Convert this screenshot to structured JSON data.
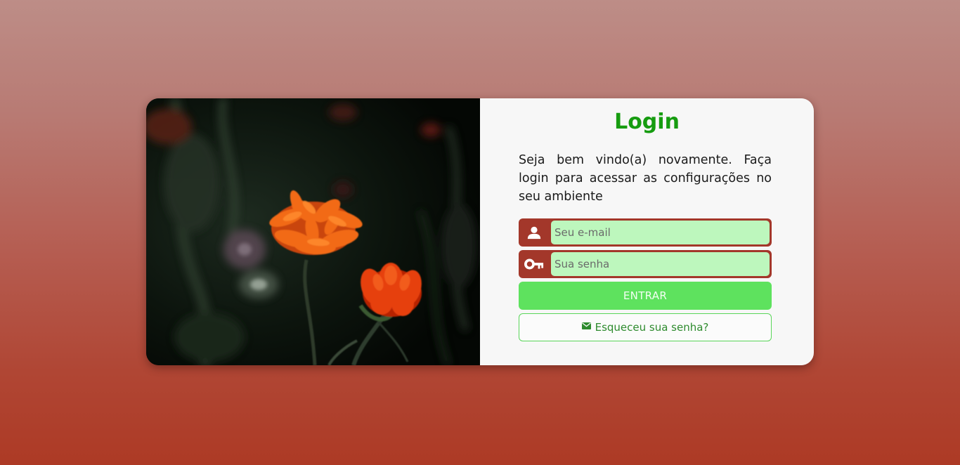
{
  "login": {
    "title": "Login",
    "subtitle": "Seja bem vindo(a) novamente. Faça login para acessar as configurações no seu ambiente",
    "email_placeholder": "Seu e-mail",
    "password_placeholder": "Sua senha",
    "submit_label": "ENTRAR",
    "forgot_label": "Esqueceu sua senha?",
    "icons": {
      "email": "user-icon",
      "password": "key-icon",
      "forgot": "envelope-icon"
    }
  },
  "colors": {
    "title": "#169c10",
    "field_frame": "#a3372a",
    "field_fill": "#bdf7bd",
    "submit_button": "#5ee25e",
    "forgot_border": "#5ad65a",
    "panel": "#f7f7f7",
    "flower": "#f05a14"
  }
}
